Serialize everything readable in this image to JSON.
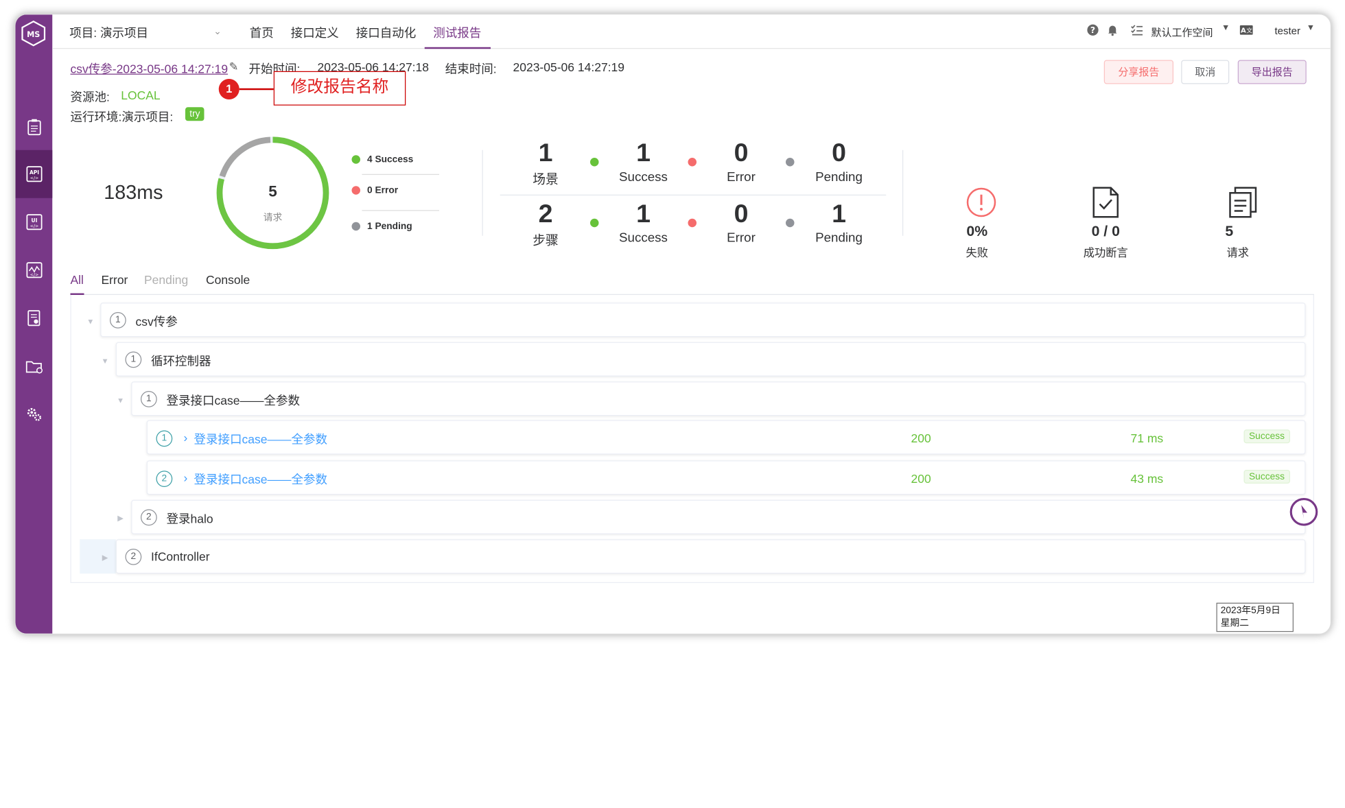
{
  "topbar": {
    "project_label": "项目: 演示项目",
    "nav": [
      "首页",
      "接口定义",
      "接口自动化",
      "测试报告"
    ],
    "active_nav": "测试报告",
    "workspace": "默认工作空间",
    "user": "tester"
  },
  "report": {
    "name": "csv传参-2023-05-06 14:27:19",
    "start_label": "开始时间:",
    "start_time": "2023-05-06 14:27:18",
    "end_label": "结束时间:",
    "end_time": "2023-05-06 14:27:19",
    "pool_label": "资源池:",
    "pool_value": "LOCAL",
    "env_label": "运行环境:演示项目:",
    "env_tag": "try"
  },
  "buttons": {
    "share": "分享报告",
    "cancel": "取消",
    "export": "导出报告"
  },
  "annotation": {
    "number": "1",
    "text": "修改报告名称"
  },
  "summary": {
    "duration": "183ms",
    "ring_total": "5",
    "ring_label": "请求",
    "legend": [
      {
        "label": "4 Success",
        "color": "#67c23a"
      },
      {
        "label": "0 Error",
        "color": "#f56c6c"
      },
      {
        "label": "1 Pending",
        "color": "#909399"
      }
    ],
    "ring_fractions": {
      "success": 0.8,
      "pending": 0.2
    },
    "scenario": {
      "count": "1",
      "label": "场景",
      "success": "1",
      "error": "0",
      "pending": "0"
    },
    "step": {
      "count": "2",
      "label": "步骤",
      "success": "1",
      "error": "0",
      "pending": "1"
    },
    "status_labels": {
      "success": "Success",
      "error": "Error",
      "pending": "Pending"
    },
    "fail_rate": "0%",
    "fail_label": "失败",
    "assert_value": "0 / 0",
    "assert_label": "成功断言",
    "request_value": "5",
    "request_label": "请求"
  },
  "tabs": [
    "All",
    "Error",
    "Pending",
    "Console"
  ],
  "tree": [
    {
      "num": "1",
      "name": "csv传参"
    },
    {
      "num": "1",
      "name": "循环控制器"
    },
    {
      "num": "1",
      "name": "登录接口case——全参数"
    },
    {
      "num": "1",
      "name": "登录接口case——全参数",
      "code": "200",
      "time": "71 ms",
      "status": "Success"
    },
    {
      "num": "2",
      "name": "登录接口case——全参数",
      "code": "200",
      "time": "43 ms",
      "status": "Success"
    },
    {
      "num": "2",
      "name": "登录halo"
    },
    {
      "num": "2",
      "name": "IfController"
    }
  ],
  "date_tooltip": {
    "date": "2023年5月9日",
    "weekday": "星期二"
  }
}
